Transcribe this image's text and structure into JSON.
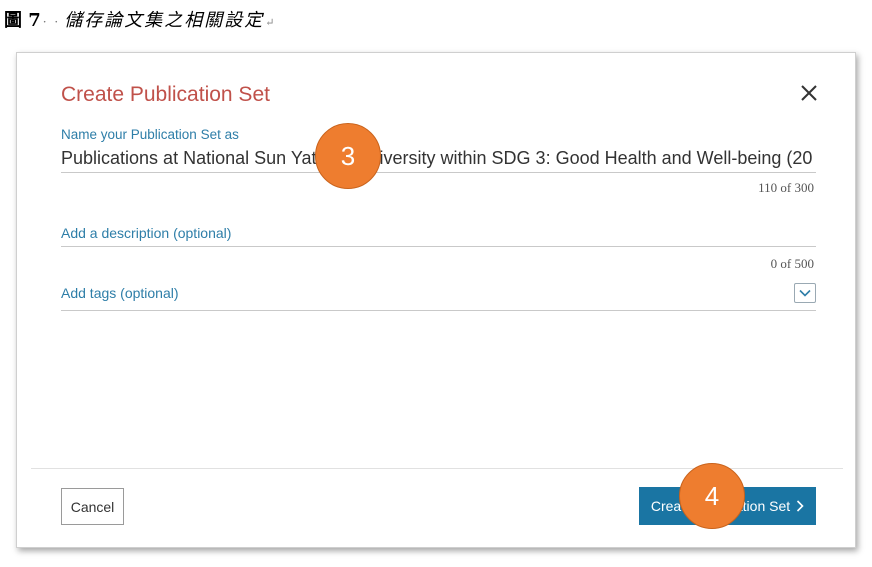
{
  "caption": {
    "label": "圖 7",
    "dots": "· ·",
    "title": "儲存論文集之相關設定",
    "paragraph_mark": "↵"
  },
  "dialog": {
    "title": "Create Publication Set",
    "close_icon": "close-icon",
    "name_field": {
      "label": "Name your Publication Set as",
      "value": "Publications at National Sun Yat-sen University within SDG 3: Good Health and Well-being (20",
      "counter": "110 of 300"
    },
    "description_field": {
      "placeholder": "Add a description (optional)",
      "counter": "0 of 500"
    },
    "tags_field": {
      "placeholder": "Add tags (optional)",
      "toggle_icon": "chevron-down-icon"
    },
    "footer": {
      "cancel_label": "Cancel",
      "create_label": "Create Publication Set",
      "create_icon": "chevron-right-icon"
    }
  },
  "callouts": {
    "step_3": "3",
    "step_4": "4"
  },
  "colors": {
    "title": "#c0514a",
    "link": "#2e7ea8",
    "primary_button": "#1a75a3",
    "callout": "#ee7d2f"
  }
}
